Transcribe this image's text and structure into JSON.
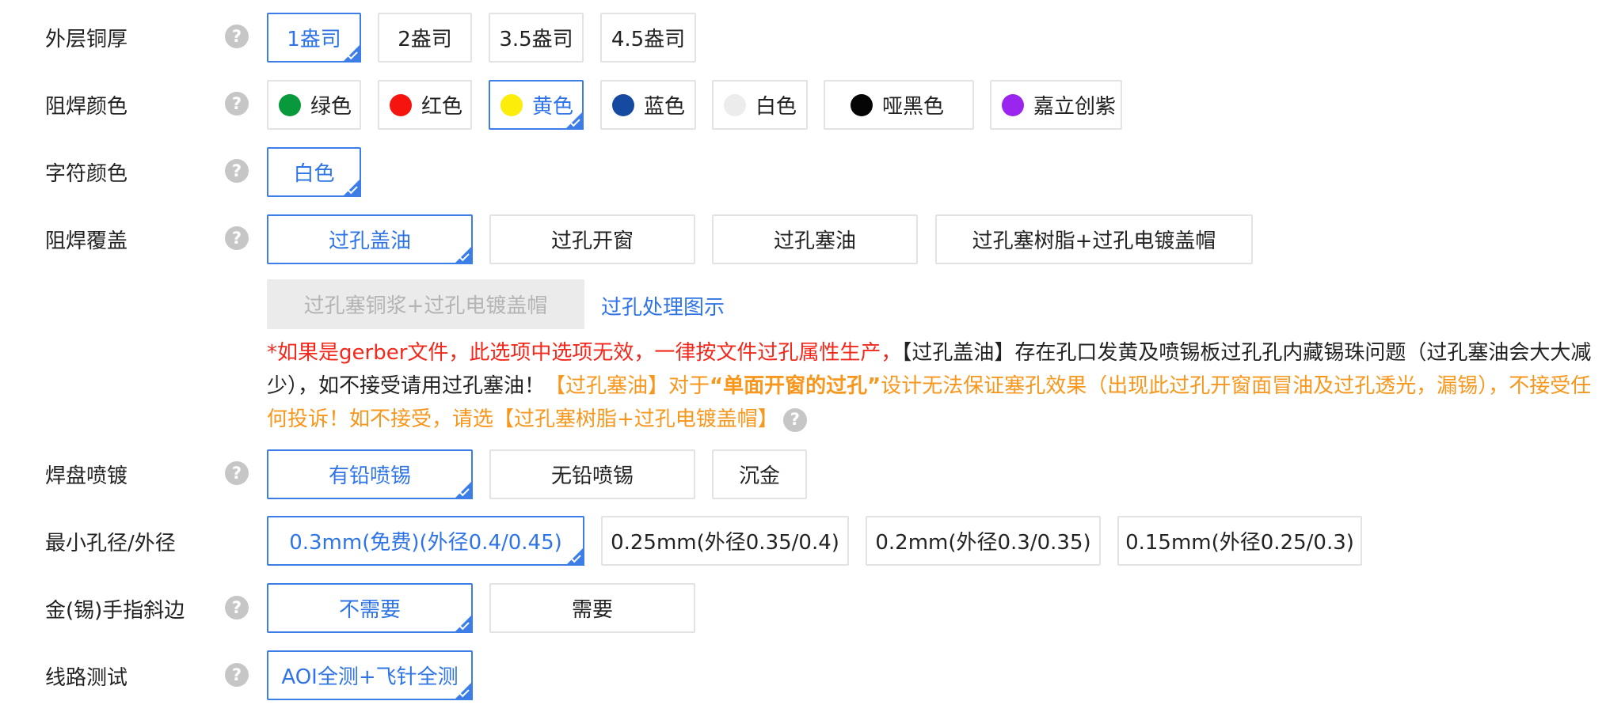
{
  "help_glyph": "?",
  "rows": {
    "copper": {
      "label": "外层铜厚",
      "options": [
        "1盎司",
        "2盎司",
        "3.5盎司",
        "4.5盎司"
      ],
      "selected": "1盎司"
    },
    "solder_mask_color": {
      "label": "阻焊颜色",
      "options": [
        {
          "label": "绿色",
          "color": "#07993b"
        },
        {
          "label": "红色",
          "color": "#f5140e"
        },
        {
          "label": "黄色",
          "color": "#fcee0a"
        },
        {
          "label": "蓝色",
          "color": "#154aa0"
        },
        {
          "label": "白色",
          "color": "#ececec"
        },
        {
          "label": "哑黑色",
          "color": "#050505"
        },
        {
          "label": "嘉立创紫",
          "color": "#9a25ee"
        }
      ],
      "selected": "黄色"
    },
    "silkscreen_color": {
      "label": "字符颜色",
      "options": [
        "白色"
      ],
      "selected": "白色"
    },
    "via_cover": {
      "label": "阻焊覆盖",
      "options": [
        "过孔盖油",
        "过孔开窗",
        "过孔塞油",
        "过孔塞树脂+过孔电镀盖帽"
      ],
      "disabled_option": "过孔塞铜浆+过孔电镀盖帽",
      "link": "过孔处理图示",
      "selected": "过孔盖油",
      "note": {
        "red": "*如果是gerber文件，此选项中选项无效，一律按文件过孔属性生产，",
        "black": "【过孔盖油】存在孔口发黄及喷锡板过孔孔内藏锡珠问题（过孔塞油会大大减少），如不接受请用过孔塞油！",
        "orange1": "【过孔塞油】对于",
        "orange_bold": "“单面开窗的过孔”",
        "orange2": "设计无法保证塞孔效果（出现此过孔开窗面冒油及过孔透光，漏锡），不接受任何投诉！如不接受，请选【过孔塞树脂+过孔电镀盖帽】"
      }
    },
    "surface_finish": {
      "label": "焊盘喷镀",
      "options": [
        "有铅喷锡",
        "无铅喷锡",
        "沉金"
      ],
      "selected": "有铅喷锡"
    },
    "min_hole": {
      "label": "最小孔径/外径",
      "options": [
        "0.3mm(免费)(外径0.4/0.45)",
        "0.25mm(外径0.35/0.4)",
        "0.2mm(外径0.3/0.35)",
        "0.15mm(外径0.25/0.3)"
      ],
      "selected": "0.3mm(免费)(外径0.4/0.45)"
    },
    "gold_finger": {
      "label": "金(锡)手指斜边",
      "options": [
        "不需要",
        "需要"
      ],
      "selected": "不需要"
    },
    "circuit_test": {
      "label": "线路测试",
      "options": [
        "AOI全测+飞针全测"
      ],
      "selected": "AOI全测+飞针全测"
    }
  },
  "theme": {
    "accent": "#3c7de8",
    "warning_red": "#f2281c",
    "warning_orange": "#f7971d"
  }
}
